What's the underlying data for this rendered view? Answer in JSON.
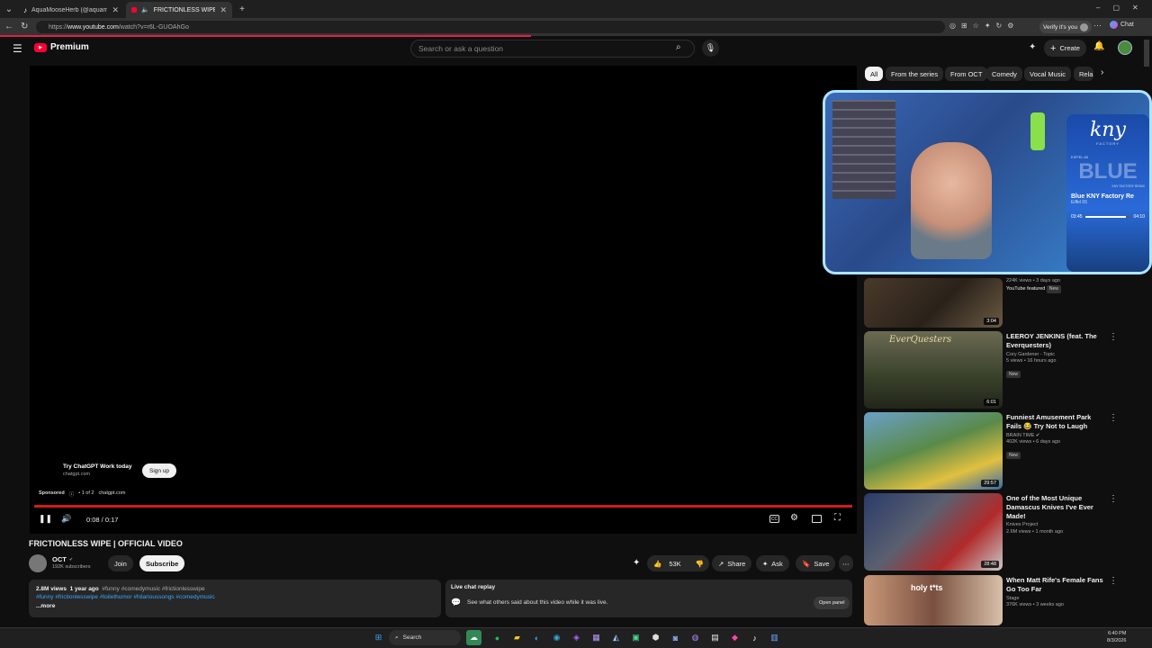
{
  "browser": {
    "tabs": [
      {
        "label": "AquaMooseHerb (@aquamooseh...",
        "icon": "tiktok-icon"
      },
      {
        "label": "FRICTIONLESS WIPE | OFFICIA",
        "icon": "youtube-icon"
      }
    ],
    "url_prefix": "https://",
    "url_domain": "www.youtube.com",
    "url_path": "/watch?v=r6L-GUOAhGo",
    "verify_label": "Verify it's you",
    "chat_label": "Chat"
  },
  "youtube": {
    "logo_text": "Premium",
    "search_placeholder": "Search or ask a question",
    "create_label": "Create",
    "chips": [
      "All",
      "From the series",
      "From OCT",
      "Comedy",
      "Vocal Music",
      "Rela"
    ]
  },
  "player": {
    "ad": {
      "title": "Try ChatGPT Work today",
      "domain": "chatgpt.com",
      "signup_label": "Sign up",
      "sponsored_label": "Sponsored",
      "ad_count": "• 1 of 2",
      "ad_domain": "chatgpt.com"
    },
    "time": "0:08 / 0:17",
    "progress": 1.0
  },
  "video": {
    "title": "FRICTIONLESS WIPE | OFFICIAL VIDEO",
    "channel": "OCT",
    "subscribers": "192K subscribers",
    "join_label": "Join",
    "subscribe_label": "Subscribe",
    "likes": "53K",
    "share_label": "Share",
    "ask_label": "Ask",
    "save_label": "Save",
    "views": "2.8M views",
    "age": "1 year ago",
    "hashtags_line1": "#funny #comedymusic #frictionlesswipe",
    "hashtags_line2": "#funny #frictionlesswipe #toilethumor #hilarioussongs #comedymusic",
    "more_label": "...more",
    "live_chat_title": "Live chat replay",
    "live_chat_text": "See what others said about this video while it was live.",
    "open_panel_label": "Open panel"
  },
  "miniplayer": {
    "track_title": "Blue KNY Factory Re",
    "track_artist": "Eiffel 65",
    "elapsed": "03:45",
    "total": "04:10",
    "progress": 0.9,
    "logo_text": "kny",
    "logo_sub": "FACTORY",
    "album_text": "BLUE",
    "album_caption": "KNY FACTORY REMIX",
    "album_artist": "EIFFEL 65"
  },
  "recommendations": [
    {
      "title": "",
      "meta1": "224K views • 3 days ago",
      "meta2": "YouTube featured",
      "badge": "New",
      "duration": "3:04"
    },
    {
      "title": "LEEROY JENKINS (feat. The Everquesters)",
      "meta1": "Cory Gardener - Topic",
      "meta2": "5 views • 16 hours ago",
      "badge": "New",
      "duration": "6:01",
      "thumb_text": "EverQuesters"
    },
    {
      "title": "Funniest Amusement Park Fails 😂 Try Not to Laugh",
      "meta1": "BRAIN TIME",
      "meta2": "402K views • 6 days ago",
      "badge": "New",
      "duration": "29:57"
    },
    {
      "title": "One of the Most Unique Damascus Knives I've Ever Made!",
      "meta1": "Knives Project",
      "meta2": "2.6M views • 1 month ago",
      "badge": "",
      "duration": "28:48"
    },
    {
      "title": "When Matt Rife's Female Fans Go Too Far",
      "meta1": "Stage",
      "meta2": "376K views • 3 weeks ago",
      "badge": "",
      "duration": "",
      "thumb_text": "holy t*ts"
    }
  ],
  "taskbar": {
    "search_label": "Search",
    "time": "6:40 PM",
    "date": "8/3/2026"
  },
  "colors": {
    "accent_red": "#ff0033",
    "progress_red": "#d31a1a",
    "bg": "#0f0f0f"
  }
}
